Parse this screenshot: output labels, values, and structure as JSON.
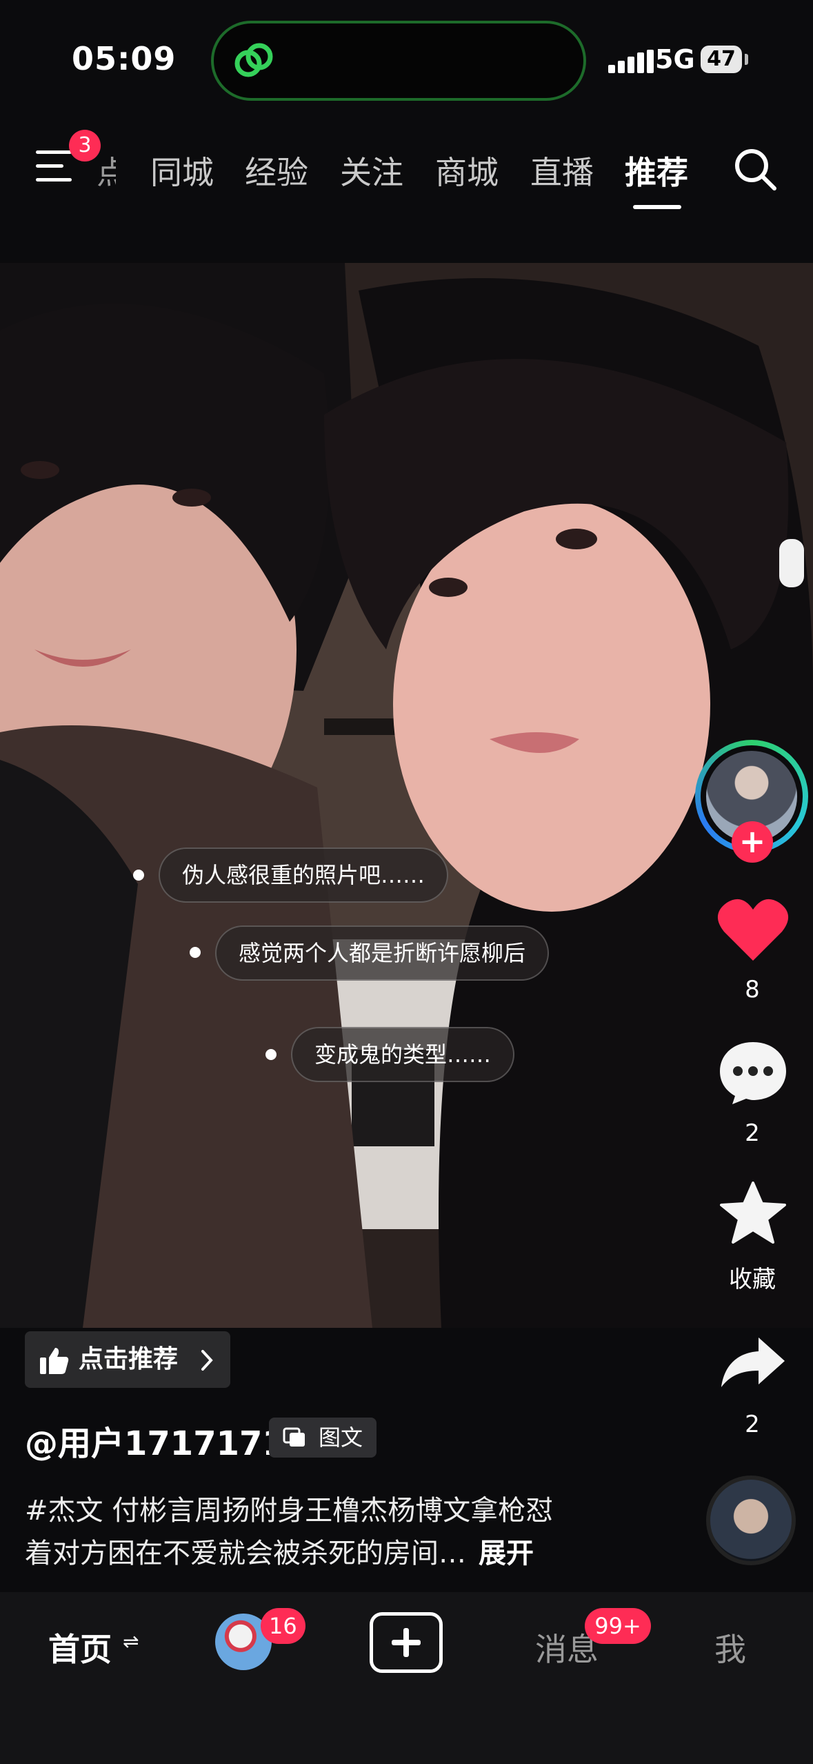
{
  "status_bar": {
    "time": "05:09",
    "network": "5G",
    "battery": "47"
  },
  "top_nav": {
    "menu_badge": "3",
    "cut_tab": "点",
    "tabs": [
      {
        "label": "同城"
      },
      {
        "label": "经验"
      },
      {
        "label": "关注"
      },
      {
        "label": "商城"
      },
      {
        "label": "直播"
      },
      {
        "label": "推荐",
        "active": true
      }
    ]
  },
  "danmaku": [
    {
      "text": "伪人感很重的照片吧……"
    },
    {
      "text": "感觉两个人都是折断许愿柳后"
    },
    {
      "text": "变成鬼的类型……"
    }
  ],
  "actions": {
    "like_count": "8",
    "comment_count": "2",
    "favorite_label": "收藏",
    "share_count": "2"
  },
  "post": {
    "recommend_label": "点击推荐",
    "username": "@用户17171717",
    "type_label": "图文",
    "caption_line1": "#杰文 付彬言周扬附身王橹杰杨博文拿枪怼",
    "caption_line2": "着对方困在不爱就会被杀死的房间…",
    "expand_label": "展开"
  },
  "tab_bar": {
    "home_label": "首页",
    "home_suffix": "⇌",
    "friends_badge": "16",
    "messages_label": "消息",
    "messages_badge": "99+",
    "me_label": "我"
  },
  "colors": {
    "accent": "#fe2c55",
    "background": "#0b0b0d",
    "island_ring": "#1d6b2a"
  }
}
